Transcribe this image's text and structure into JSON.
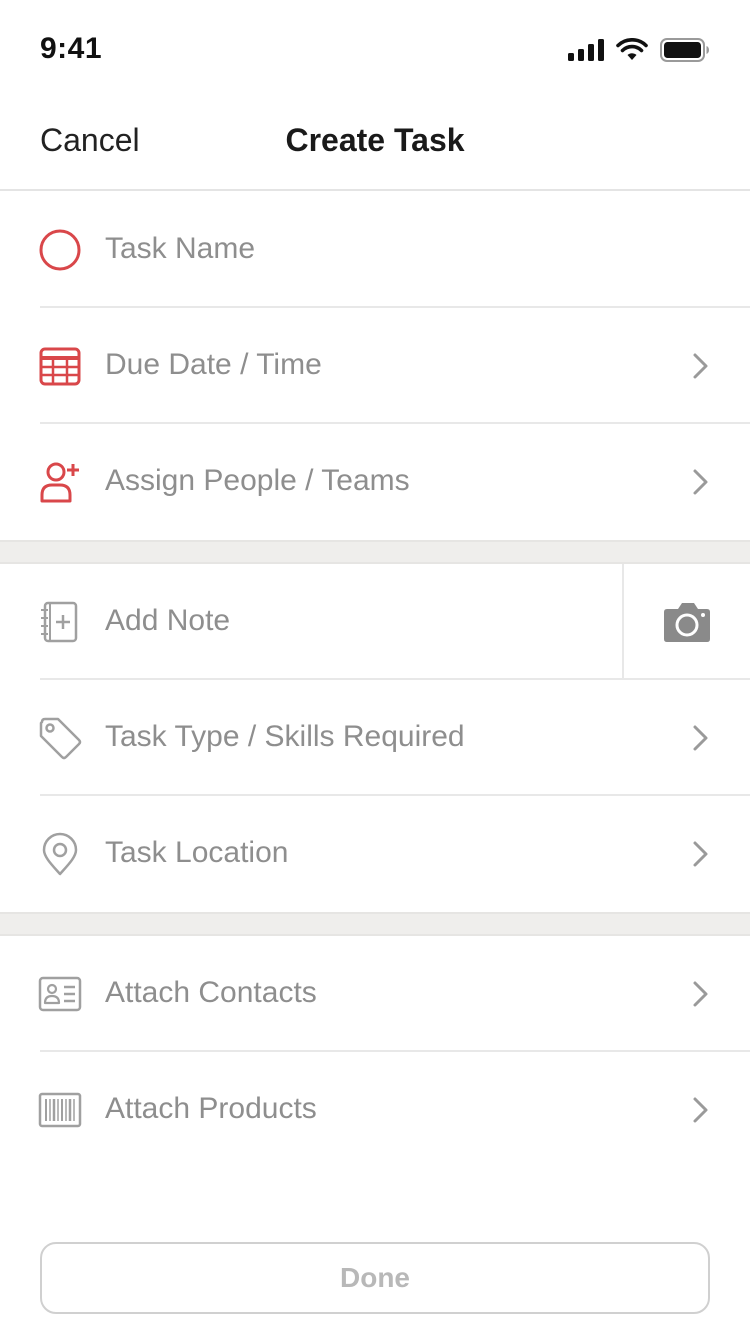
{
  "status_bar": {
    "time": "9:41"
  },
  "nav": {
    "cancel_label": "Cancel",
    "title": "Create Task"
  },
  "rows": {
    "task_name": {
      "label": "Task Name",
      "icon": "circle-icon"
    },
    "due_date": {
      "label": "Due Date / Time",
      "icon": "calendar-icon"
    },
    "assign": {
      "label": "Assign People / Teams",
      "icon": "add-person-icon"
    },
    "add_note": {
      "label": "Add Note",
      "icon": "note-add-icon"
    },
    "task_type": {
      "label": "Task Type / Skills Required",
      "icon": "tag-icon"
    },
    "location": {
      "label": "Task Location",
      "icon": "location-pin-icon"
    },
    "contacts": {
      "label": "Attach Contacts",
      "icon": "contact-card-icon"
    },
    "products": {
      "label": "Attach Products",
      "icon": "barcode-icon"
    }
  },
  "done_label": "Done",
  "colors": {
    "accent": "#d9474a",
    "placeholder": "#8e8e8e",
    "icon_gray": "#a0a0a0",
    "section_bg": "#efeeec"
  }
}
